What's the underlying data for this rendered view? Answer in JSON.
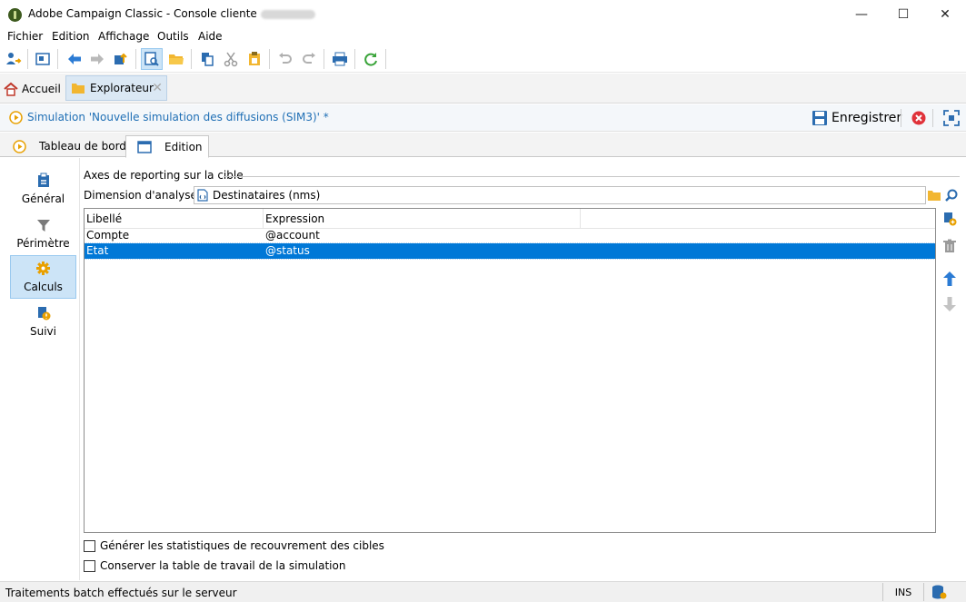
{
  "window": {
    "title": "Adobe Campaign Classic - Console cliente",
    "minimize_glyph": "—",
    "maximize_glyph": "☐",
    "close_glyph": "✕"
  },
  "menu": [
    "Fichier",
    "Edition",
    "Affichage",
    "Outils",
    "Aide"
  ],
  "toolbar_icons": [
    "logon-icon",
    "view-icon",
    "back-arrow-icon",
    "forward-arrow-icon",
    "upload-icon",
    "preview-icon",
    "open-folder-icon",
    "copy-icon",
    "cut-icon",
    "paste-icon",
    "undo-icon",
    "redo-icon",
    "print-icon",
    "refresh-icon"
  ],
  "tabs": {
    "home": "Accueil",
    "explorer": "Explorateur",
    "explorer_close": "✕"
  },
  "header": {
    "title": "Simulation 'Nouvelle simulation des diffusions (SIM3)' *",
    "save_label": "Enregistrer"
  },
  "subtabs": {
    "dashboard": "Tableau de bord",
    "edition": "Edition"
  },
  "sidebar": {
    "items": [
      {
        "label": "Général",
        "icon": "clipboard-icon"
      },
      {
        "label": "Périmètre",
        "icon": "filter-icon"
      },
      {
        "label": "Calculs",
        "icon": "gear-icon"
      },
      {
        "label": "Suivi",
        "icon": "tracking-icon"
      }
    ],
    "active": "Calculs"
  },
  "content": {
    "group_label": "Axes de reporting sur la cible",
    "dimension_label": "Dimension d'analyse :",
    "dimension_value": "Destinataires (nms)",
    "grid": {
      "headers": [
        "Libellé",
        "Expression"
      ],
      "rows": [
        {
          "label": "Compte",
          "expression": "@account"
        },
        {
          "label": "Etat",
          "expression": "@status",
          "selected": true
        }
      ]
    },
    "checkbox_overlap": "Générer les statistiques de recouvrement des cibles",
    "checkbox_keep_table": "Conserver la table de travail de la simulation"
  },
  "status": {
    "text": "Traitements batch effectués sur le serveur",
    "mode": "INS"
  },
  "colors": {
    "accent": "#0078d7",
    "selection": "#cce4f7",
    "title_blue": "#1f6fb5",
    "cancel_red": "#e0323a",
    "refresh_green": "#3aa43a",
    "folder_yellow": "#f2b630"
  }
}
